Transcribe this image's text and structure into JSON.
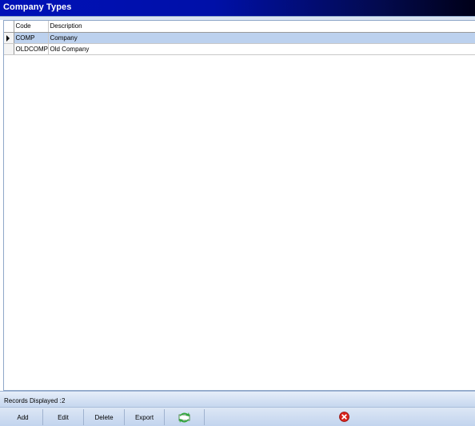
{
  "window": {
    "title": "Company Types"
  },
  "grid": {
    "columns": [
      "Code",
      "Description"
    ],
    "rows": [
      {
        "code": "COMP",
        "description": "Company",
        "selected": true
      },
      {
        "code": "OLDCOMP",
        "description": "Old Company",
        "selected": false
      }
    ]
  },
  "status": {
    "records_label": "Records Displayed :",
    "records_count": "2"
  },
  "toolbar": {
    "add_label": "Add",
    "edit_label": "Edit",
    "delete_label": "Delete",
    "export_label": "Export",
    "refresh_icon": "refresh-icon",
    "close_icon": "close-icon"
  },
  "colors": {
    "title_bar": "#0011b8",
    "selected_row": "#bcd1ee",
    "refresh_green": "#2fa83a",
    "close_red": "#d8221c"
  }
}
